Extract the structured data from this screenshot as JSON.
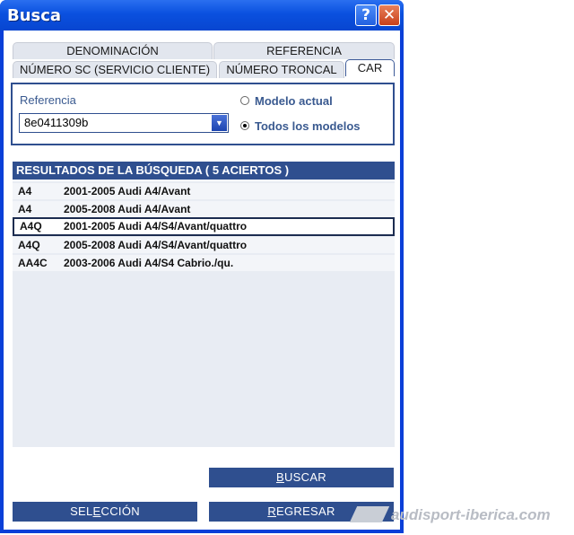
{
  "window": {
    "title": "Busca",
    "help_label": "?",
    "close_label": "✕"
  },
  "tabs_row1": [
    {
      "label": "DENOMINACIÓN"
    },
    {
      "label": "REFERENCIA"
    }
  ],
  "tabs_row2": [
    {
      "label": "NÚMERO SC (SERVICIO CLIENTE)"
    },
    {
      "label": "NÚMERO TRONCAL"
    },
    {
      "label": "CAR",
      "active": true
    }
  ],
  "search": {
    "label": "Referencia",
    "value": "8e0411309b",
    "dropdown_icon": "triangle-down-icon",
    "radio_current": "Modelo actual",
    "radio_all": "Todos los modelos",
    "selected_option": "Todos los modelos"
  },
  "results": {
    "header": "RESULTADOS DE LA BÚSQUEDA  ( 5 ACIERTOS )",
    "rows": [
      {
        "code": "A4",
        "desc": "2001-2005 Audi A4/Avant"
      },
      {
        "code": "A4",
        "desc": "2005-2008 Audi A4/Avant"
      },
      {
        "code": "A4Q",
        "desc": "2001-2005 Audi A4/S4/Avant/quattro",
        "selected": true
      },
      {
        "code": "A4Q",
        "desc": "2005-2008 Audi A4/S4/Avant/quattro"
      },
      {
        "code": "AA4C",
        "desc": "2003-2006 Audi A4/S4 Cabrio./qu."
      }
    ]
  },
  "buttons": {
    "buscar_pre": "",
    "buscar_key": "B",
    "buscar_post": "USCAR",
    "seleccion_pre": "SEL",
    "seleccion_key": "E",
    "seleccion_post": "CCIÓN",
    "regresar_pre": "",
    "regresar_key": "R",
    "regresar_post": "EGRESAR"
  },
  "watermark": {
    "text": "audisport-iberica.com"
  },
  "colors": {
    "xp_blue": "#0a50df",
    "panel_blue": "#2f4f8f",
    "label_blue": "#3a5a90"
  }
}
